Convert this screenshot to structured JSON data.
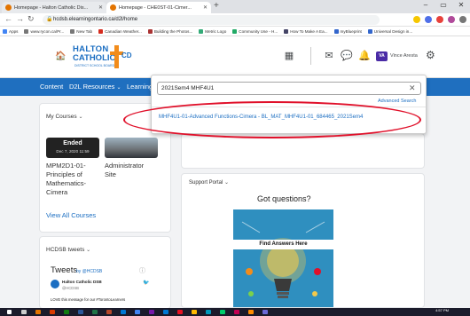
{
  "browser": {
    "tabs": [
      {
        "title": "Homepage - Halton Catholic Dis..."
      },
      {
        "title": "Homepage - CHE0ST-01-Cimer..."
      }
    ],
    "new_tab": "+",
    "window_controls": [
      "–",
      "▭",
      "✕"
    ],
    "url": "hcdsb.elearningontario.ca/d2l/home",
    "bookmarks": [
      "Apps",
      "www.rycon.ca/Pr...",
      "New Tab",
      "Canadian Weather...",
      "Building the Photos...",
      "Metric Logo",
      "Community Use - H...",
      "How To Make A Ea...",
      "myBlueprint",
      "Universal Design in..."
    ]
  },
  "header": {
    "logo_line1": "HALTON",
    "logo_line2": "CATHOLIC",
    "logo_sub": "DISTRICT SCHOOL BOARD",
    "logo_cd": "CD",
    "avatar_initials": "VA",
    "user_name": "Vince Aresta"
  },
  "navbar": {
    "items": [
      "Content",
      "D2L Resources",
      "Learning"
    ]
  },
  "search": {
    "query": "2021Sem4 MHF4U1",
    "advanced_label": "Advanced Search",
    "results": [
      "MHF4U1-01-Advanced Functions-Cimera - BL_MAT_MHF4U1-01_684465_2021Sem4"
    ]
  },
  "my_courses": {
    "title": "My Courses",
    "courses": [
      {
        "badge": "Ended",
        "date": "Dec 7, 2020 11:59",
        "name_lines": [
          "MPM2D1-01-",
          "Principles of",
          "Mathematics-",
          "Cimera"
        ]
      },
      {
        "name_lines": [
          "Administrator",
          "Site"
        ]
      }
    ],
    "view_all": "View All Courses"
  },
  "support_portal": {
    "title": "Support Portal",
    "heading": "Got questions?",
    "banner": "Find Answers Here"
  },
  "tweets": {
    "widget_title": "HCDSB tweets",
    "heading": "Tweets",
    "by": "by @HCDSB",
    "author": "Halton Catholic DSB",
    "handle": "@HCDSB",
    "text": "LOVE this message for our #TorontoLearners"
  },
  "taskbar": {
    "time": "4:57 PM"
  },
  "colors": {
    "navbar": "#1f6fbf",
    "link": "#1b6ec2",
    "annotation_circle": "#e0102a",
    "avatar": "#4a2ba6"
  }
}
